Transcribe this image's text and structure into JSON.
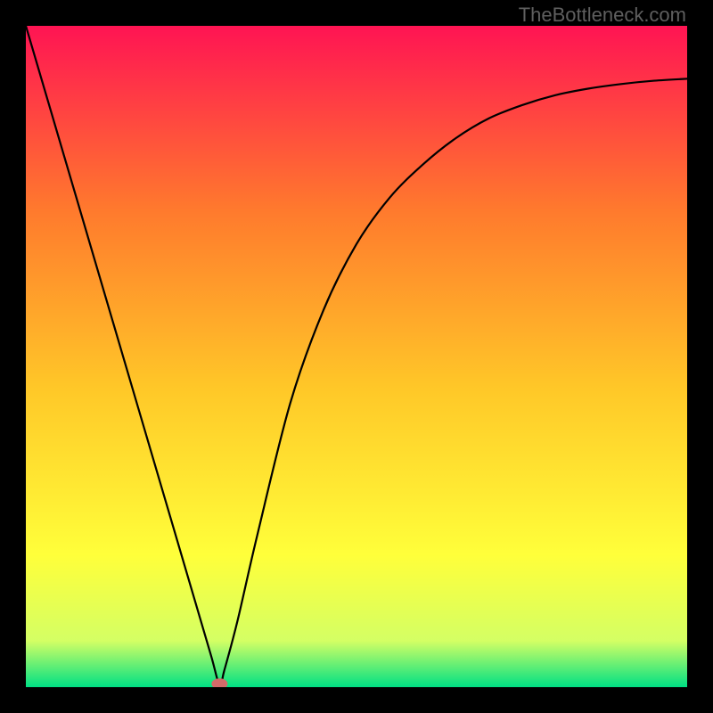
{
  "watermark": "TheBottleneck.com",
  "chart_data": {
    "type": "line",
    "title": "",
    "xlabel": "",
    "ylabel": "",
    "xlim": [
      0,
      1
    ],
    "ylim": [
      0,
      1
    ],
    "grid": false,
    "legend": false,
    "background_gradient": {
      "top": "#ff1453",
      "mid_upper": "#ff7a2d",
      "mid": "#ffc828",
      "mid_lower": "#ffff3a",
      "near_bottom": "#d4ff64",
      "bottom": "#00e084"
    },
    "marker": {
      "x": 0.293,
      "y": 0.005,
      "color": "#d36a6a",
      "shape": "ellipse"
    },
    "series": [
      {
        "name": "curve",
        "x": [
          0.0,
          0.05,
          0.1,
          0.15,
          0.2,
          0.25,
          0.28,
          0.293,
          0.3,
          0.32,
          0.35,
          0.4,
          0.45,
          0.5,
          0.55,
          0.6,
          0.65,
          0.7,
          0.75,
          0.8,
          0.85,
          0.9,
          0.95,
          1.0
        ],
        "y": [
          1.0,
          0.83,
          0.66,
          0.49,
          0.32,
          0.15,
          0.048,
          0.003,
          0.025,
          0.1,
          0.23,
          0.43,
          0.57,
          0.67,
          0.74,
          0.79,
          0.83,
          0.86,
          0.88,
          0.895,
          0.905,
          0.912,
          0.917,
          0.92
        ]
      }
    ]
  }
}
